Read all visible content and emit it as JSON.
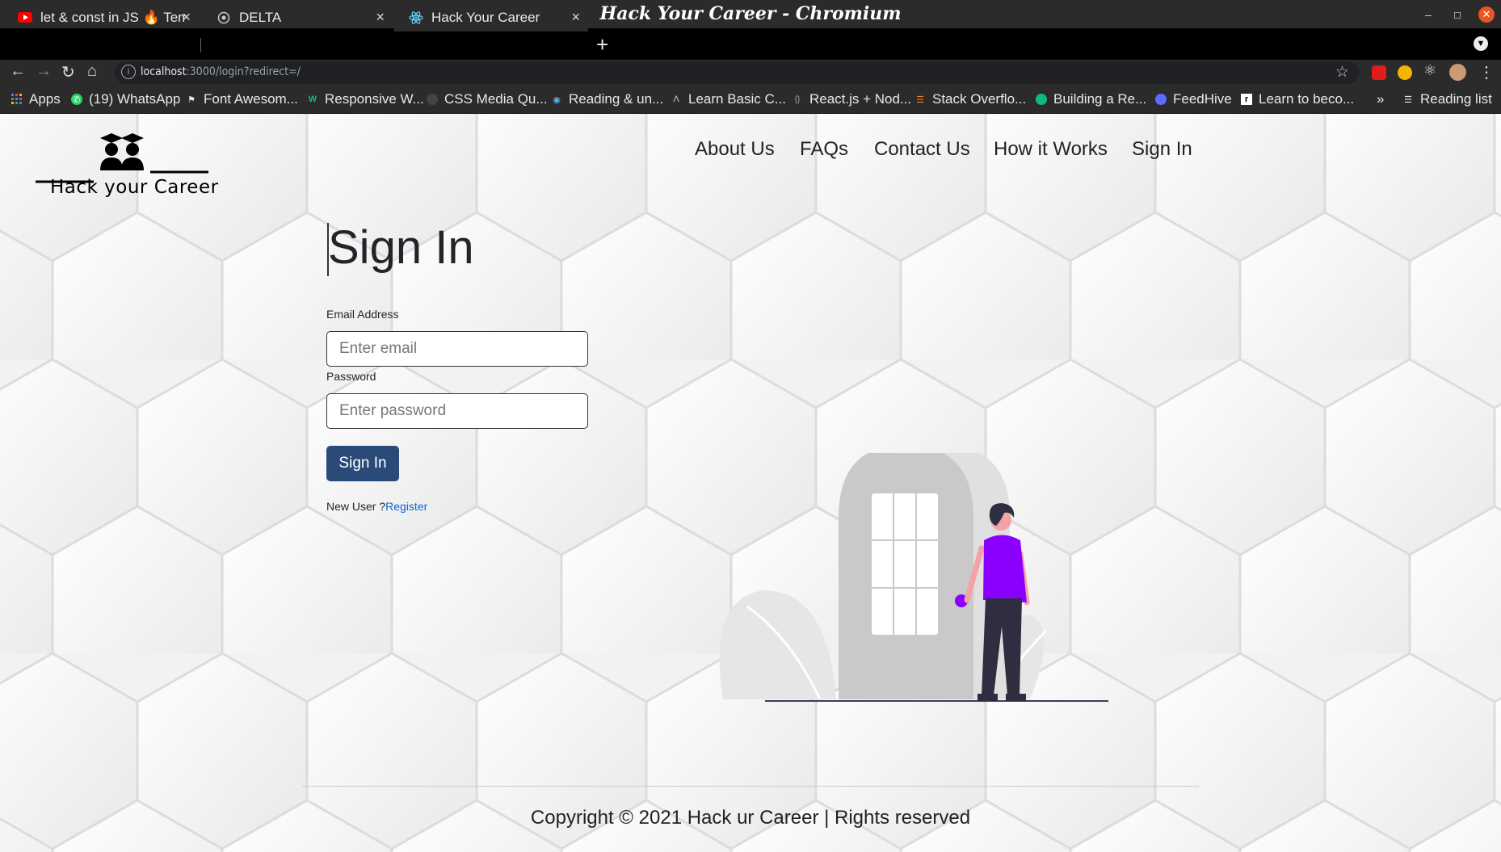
{
  "window": {
    "title": "Hack Your Career - Chromium"
  },
  "tabs": [
    {
      "label": "let & const in JS 🔥 Temp",
      "icon": "youtube-icon"
    },
    {
      "label": "DELTA",
      "icon": "globe-icon"
    },
    {
      "label": "Hack Your Career",
      "icon": "react-icon",
      "active": true
    }
  ],
  "address_bar": {
    "host": "localhost",
    "rest": ":3000/login?redirect=/"
  },
  "bookmarks": [
    {
      "label": "Apps",
      "icon": "apps-grid-icon"
    },
    {
      "label": "(19) WhatsApp",
      "icon": "whatsapp-icon"
    },
    {
      "label": "Font Awesom...",
      "icon": "flag-icon"
    },
    {
      "label": "Responsive W...",
      "icon": "w-logo-icon"
    },
    {
      "label": "CSS Media Qu...",
      "icon": "github-icon"
    },
    {
      "label": "Reading & un...",
      "icon": "eye-icon"
    },
    {
      "label": "Learn Basic C...",
      "icon": "a-logo-icon"
    },
    {
      "label": "React.js + Nod...",
      "icon": "braces-icon"
    },
    {
      "label": "Stack Overflo...",
      "icon": "stackoverflow-icon"
    },
    {
      "label": "Building a Re...",
      "icon": "c-logo-icon"
    },
    {
      "label": "FeedHive",
      "icon": "feedhive-icon"
    },
    {
      "label": "Learn to beco...",
      "icon": "r-logo-icon"
    }
  ],
  "reading_list": "Reading list",
  "site": {
    "logo_text": "Hack your Career",
    "nav": [
      "About Us",
      "FAQs",
      "Contact Us",
      "How it Works",
      "Sign In"
    ]
  },
  "form": {
    "title": "Sign In",
    "email_label": "Email Address",
    "email_placeholder": "Enter email",
    "password_label": "Password",
    "password_placeholder": "Enter password",
    "submit_label": "Sign In",
    "new_user_text": "New User ?",
    "register_link": "Register"
  },
  "footer": {
    "text": "Copyright © 2021 Hack ur Career | Rights reserved"
  },
  "colors": {
    "primary_button": "#2a4a78",
    "link": "#0b66d6",
    "figure_shirt": "#8a00ff"
  }
}
